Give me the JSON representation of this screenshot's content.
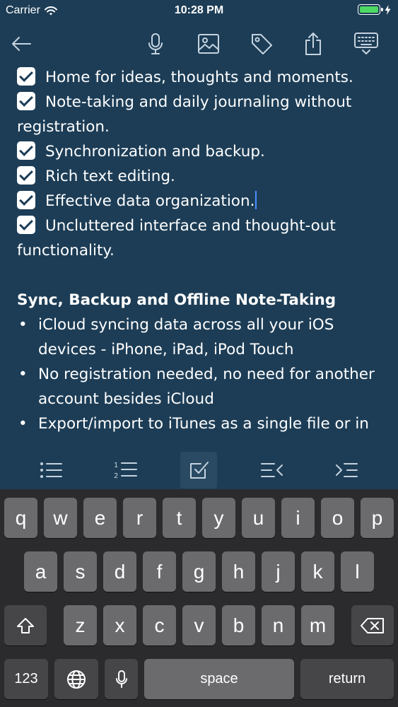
{
  "status_bar": {
    "carrier": "Carrier",
    "time": "10:28 PM",
    "battery_level": 1.0,
    "battery_color": "#4cd964"
  },
  "toolbar": {
    "icons": [
      "back-arrow-icon",
      "microphone-icon",
      "image-icon",
      "tag-icon",
      "share-icon",
      "keyboard-dismiss-icon"
    ]
  },
  "note": {
    "checklist": [
      {
        "text": "Home for ideas, thoughts and moments.",
        "checked": true
      },
      {
        "text": "Note-taking and daily journaling without registration.",
        "checked": true
      },
      {
        "text": "Synchronization and backup.",
        "checked": true
      },
      {
        "text": "Rich text editing.",
        "checked": true
      },
      {
        "text": "Effective data organization.",
        "checked": true
      },
      {
        "text": "Uncluttered interface and thought-out functionality.",
        "checked": true
      }
    ],
    "section_title": "Sync, Backup and Offline Note-Taking",
    "bullets": [
      "iCloud syncing data across all your iOS devices - iPhone, iPad, iPod Touch",
      "No registration needed, no need for another account besides iCloud",
      "Export/import to iTunes as a single file or in"
    ],
    "bullet_symbol": "•"
  },
  "format_bar": {
    "icons": [
      "bullet-list-icon",
      "numbered-list-icon",
      "checklist-icon",
      "outdent-icon",
      "indent-icon"
    ],
    "active": "checklist-icon",
    "numbered_list_digits": [
      "1",
      "2"
    ]
  },
  "keyboard": {
    "row1": [
      "q",
      "w",
      "e",
      "r",
      "t",
      "y",
      "u",
      "i",
      "o",
      "p"
    ],
    "row2": [
      "a",
      "s",
      "d",
      "f",
      "g",
      "h",
      "j",
      "k",
      "l"
    ],
    "row3": [
      "z",
      "x",
      "c",
      "v",
      "b",
      "n",
      "m"
    ],
    "numbers_label": "123",
    "space_label": "space",
    "return_label": "return"
  },
  "colors": {
    "background": "#1d3d56",
    "keyboard": "#2b2b2d",
    "key": "#6b6b6e",
    "key_dark": "#464649",
    "caret": "#4a90ff"
  }
}
